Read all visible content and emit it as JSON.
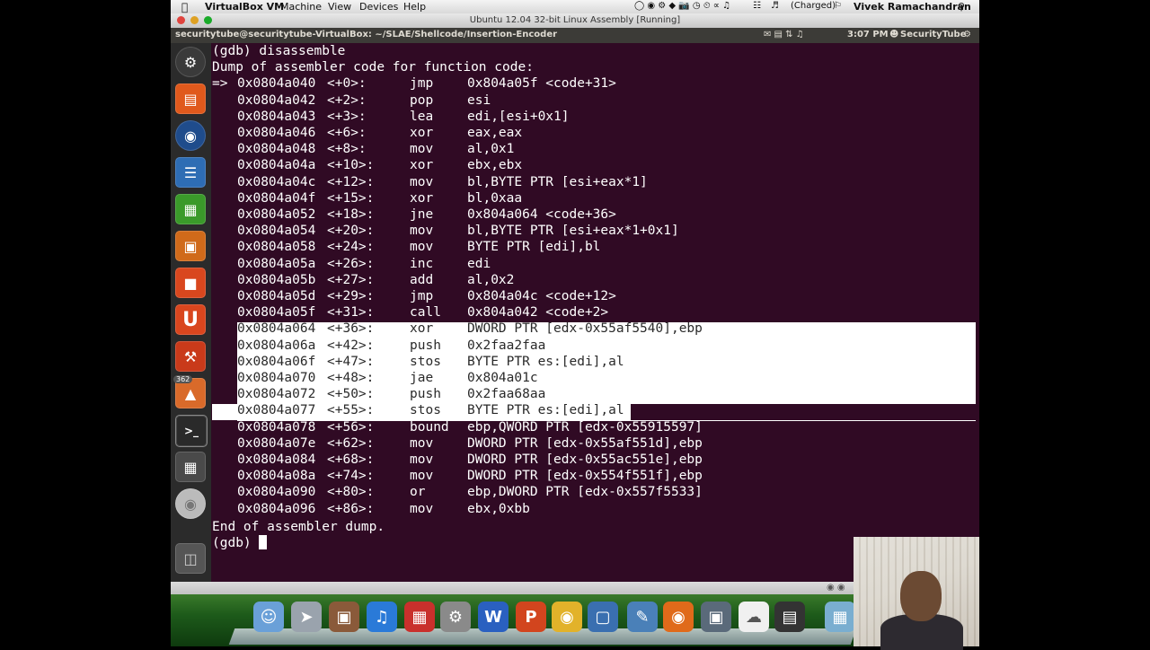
{
  "mac_menu": {
    "app": "VirtualBox VM",
    "items": [
      "Machine",
      "View",
      "Devices",
      "Help"
    ],
    "battery": "(Charged)",
    "user": "Vivek Ramachandran"
  },
  "window": {
    "title": "Ubuntu 12.04 32-bit Linux Assembly [Running]"
  },
  "ubuntu_panel": {
    "title": "securitytube@securitytube-VirtualBox: ~/SLAE/Shellcode/Insertion-Encoder",
    "time": "3:07 PM",
    "user": "SecurityTube"
  },
  "launcher": {
    "badge": "362"
  },
  "terminal": {
    "command_line": "(gdb) disassemble",
    "header": "Dump of assembler code for function code:",
    "instructions": [
      {
        "marker": "=>",
        "addr": "0x0804a040",
        "off": "<+0>:",
        "mn": "jmp",
        "ops": "0x804a05f <code+31>"
      },
      {
        "marker": "",
        "addr": "0x0804a042",
        "off": "<+2>:",
        "mn": "pop",
        "ops": "esi"
      },
      {
        "marker": "",
        "addr": "0x0804a043",
        "off": "<+3>:",
        "mn": "lea",
        "ops": "edi,[esi+0x1]"
      },
      {
        "marker": "",
        "addr": "0x0804a046",
        "off": "<+6>:",
        "mn": "xor",
        "ops": "eax,eax"
      },
      {
        "marker": "",
        "addr": "0x0804a048",
        "off": "<+8>:",
        "mn": "mov",
        "ops": "al,0x1"
      },
      {
        "marker": "",
        "addr": "0x0804a04a",
        "off": "<+10>:",
        "mn": "xor",
        "ops": "ebx,ebx"
      },
      {
        "marker": "",
        "addr": "0x0804a04c",
        "off": "<+12>:",
        "mn": "mov",
        "ops": "bl,BYTE PTR [esi+eax*1]"
      },
      {
        "marker": "",
        "addr": "0x0804a04f",
        "off": "<+15>:",
        "mn": "xor",
        "ops": "bl,0xaa"
      },
      {
        "marker": "",
        "addr": "0x0804a052",
        "off": "<+18>:",
        "mn": "jne",
        "ops": "0x804a064 <code+36>"
      },
      {
        "marker": "",
        "addr": "0x0804a054",
        "off": "<+20>:",
        "mn": "mov",
        "ops": "bl,BYTE PTR [esi+eax*1+0x1]"
      },
      {
        "marker": "",
        "addr": "0x0804a058",
        "off": "<+24>:",
        "mn": "mov",
        "ops": "BYTE PTR [edi],bl"
      },
      {
        "marker": "",
        "addr": "0x0804a05a",
        "off": "<+26>:",
        "mn": "inc",
        "ops": "edi"
      },
      {
        "marker": "",
        "addr": "0x0804a05b",
        "off": "<+27>:",
        "mn": "add",
        "ops": "al,0x2"
      },
      {
        "marker": "",
        "addr": "0x0804a05d",
        "off": "<+29>:",
        "mn": "jmp",
        "ops": "0x804a04c <code+12>"
      },
      {
        "marker": "",
        "addr": "0x0804a05f",
        "off": "<+31>:",
        "mn": "call",
        "ops": "0x804a042 <code+2>"
      },
      {
        "marker": "",
        "addr": "0x0804a064",
        "off": "<+36>:",
        "mn": "xor",
        "ops": "DWORD PTR [edx-0x55af5540],ebp"
      },
      {
        "marker": "",
        "addr": "0x0804a06a",
        "off": "<+42>:",
        "mn": "push",
        "ops": "0x2faa2faa"
      },
      {
        "marker": "",
        "addr": "0x0804a06f",
        "off": "<+47>:",
        "mn": "stos",
        "ops": "BYTE PTR es:[edi],al"
      },
      {
        "marker": "",
        "addr": "0x0804a070",
        "off": "<+48>:",
        "mn": "jae",
        "ops": "0x804a01c"
      },
      {
        "marker": "",
        "addr": "0x0804a072",
        "off": "<+50>:",
        "mn": "push",
        "ops": "0x2faa68aa"
      },
      {
        "marker": "",
        "addr": "0x0804a077",
        "off": "<+55>:",
        "mn": "stos",
        "ops": "BYTE PTR es:[edi],al"
      },
      {
        "marker": "",
        "addr": "0x0804a078",
        "off": "<+56>:",
        "mn": "bound",
        "ops": "ebp,QWORD PTR [edx-0x55915597]"
      },
      {
        "marker": "",
        "addr": "0x0804a07e",
        "off": "<+62>:",
        "mn": "mov",
        "ops": "DWORD PTR [edx-0x55af551d],ebp"
      },
      {
        "marker": "",
        "addr": "0x0804a084",
        "off": "<+68>:",
        "mn": "mov",
        "ops": "DWORD PTR [edx-0x55ac551e],ebp"
      },
      {
        "marker": "",
        "addr": "0x0804a08a",
        "off": "<+74>:",
        "mn": "mov",
        "ops": "DWORD PTR [edx-0x554f551f],ebp"
      },
      {
        "marker": "",
        "addr": "0x0804a090",
        "off": "<+80>:",
        "mn": "or",
        "ops": "ebp,DWORD PTR [edx-0x557f5533]"
      },
      {
        "marker": "",
        "addr": "0x0804a096",
        "off": "<+86>:",
        "mn": "mov",
        "ops": "ebx,0xbb"
      }
    ],
    "footer": "End of assembler dump.",
    "prompt": "(gdb) "
  },
  "colors": {
    "terminal_bg": "#300a24",
    "panel_bg": "#3c3b37",
    "launcher_bg": "#2b2b2b",
    "selection": "#ffffff"
  },
  "dock_icons": [
    "finder-icon",
    "launchpad-icon",
    "photo-booth-icon",
    "itunes-icon",
    "photo-icon",
    "system-preferences-icon",
    "word-icon",
    "powerpoint-icon",
    "chrome-icon",
    "virtualbox-icon",
    "preview-icon",
    "firefox-icon",
    "keynote-icon",
    "sheep-icon",
    "terminal-icon",
    "folder-icon"
  ]
}
